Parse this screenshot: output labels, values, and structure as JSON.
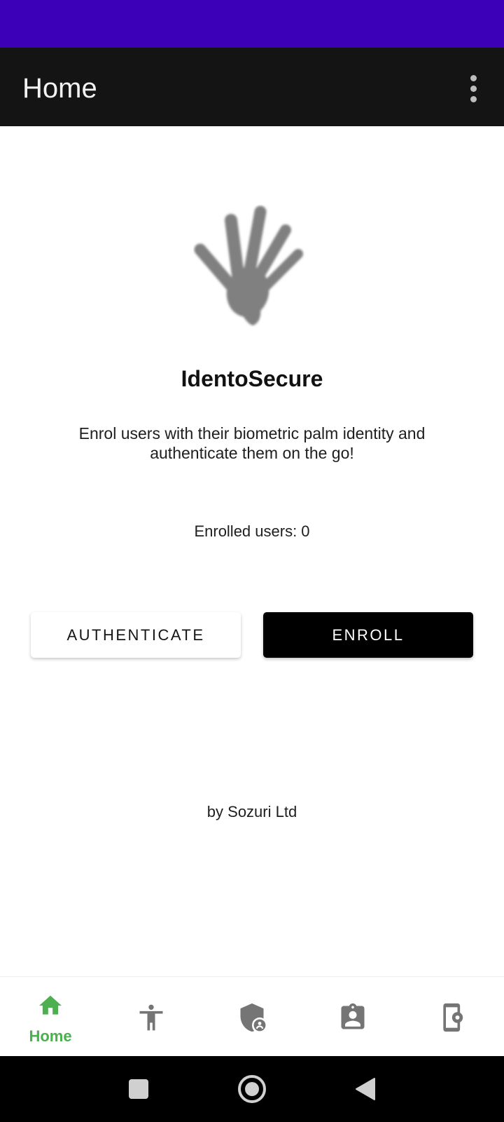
{
  "app_bar": {
    "title": "Home",
    "menu_icon": "more-vert-icon"
  },
  "hero": {
    "icon": "palm-hand-icon",
    "title": "IdentoSecure",
    "tagline": "Enrol users with their biometric palm identity and authenticate them on the go!",
    "enrolled_text": "Enrolled users: 0"
  },
  "actions": {
    "authenticate_label": "AUTHENTICATE",
    "enroll_label": "ENROLL"
  },
  "footer": {
    "credit": "by Sozuri Ltd"
  },
  "bottom_nav": {
    "items": [
      {
        "icon": "home-icon",
        "label": "Home",
        "selected": true
      },
      {
        "icon": "accessibility-icon",
        "label": "",
        "selected": false
      },
      {
        "icon": "admin-shield-icon",
        "label": "",
        "selected": false
      },
      {
        "icon": "assignment-ind-icon",
        "label": "",
        "selected": false
      },
      {
        "icon": "device-settings-icon",
        "label": "",
        "selected": false
      }
    ]
  },
  "system_nav": {
    "items": [
      "recents-icon",
      "home-circle-icon",
      "back-icon"
    ]
  },
  "colors": {
    "status_bar": "#3c00b8",
    "app_bar": "#141414",
    "accent": "#4caf50",
    "icon_gray": "#757575"
  }
}
